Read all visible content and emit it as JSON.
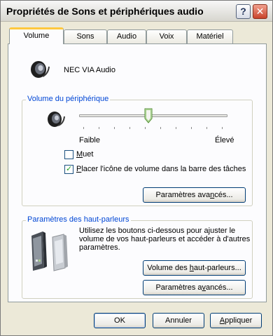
{
  "window": {
    "title": "Propriétés de Sons et périphériques audio",
    "help_glyph": "?",
    "close_glyph": "✕"
  },
  "tabs": [
    {
      "label": "Volume",
      "active": true
    },
    {
      "label": "Sons",
      "active": false
    },
    {
      "label": "Audio",
      "active": false
    },
    {
      "label": "Voix",
      "active": false
    },
    {
      "label": "Matériel",
      "active": false
    }
  ],
  "device": {
    "name": "NEC VIA Audio",
    "icon": "speaker-icon"
  },
  "volume_group": {
    "label": "Volume du périphérique",
    "slider": {
      "min_label": "Faible",
      "max_label": "Élevé",
      "level": 0.45
    },
    "mute": {
      "label_pre": "",
      "label_ul": "M",
      "label_post": "uet",
      "checked": false
    },
    "tray_icon": {
      "label_pre": "",
      "label_ul": "P",
      "label_post": "lacer l'icône de volume dans la barre des tâches",
      "checked": true
    },
    "advanced_button": {
      "label_pre": "Paramètres ava",
      "label_ul": "n",
      "label_post": "cés..."
    }
  },
  "speakers_group": {
    "label": "Paramètres des haut-parleurs",
    "description": "Utilisez les boutons ci-dessous pour ajuster le volume de vos haut-parleurs et accéder à d'autres paramètres.",
    "volume_button": {
      "label_pre": "Volume des ",
      "label_ul": "h",
      "label_post": "aut-parleurs..."
    },
    "advanced_button": {
      "label_pre": "Paramètres a",
      "label_ul": "v",
      "label_post": "ancés..."
    },
    "icon": "speakers-icon"
  },
  "footer": {
    "ok": "OK",
    "cancel": "Annuler",
    "apply_ul": "A",
    "apply_post": "ppliquer"
  },
  "colors": {
    "dialog_bg": "#ece9d8",
    "panel_bg": "#fcfcfe",
    "group_label": "#0046d5",
    "active_tab_accent": "#ffc83d",
    "checkmark": "#21a121"
  }
}
